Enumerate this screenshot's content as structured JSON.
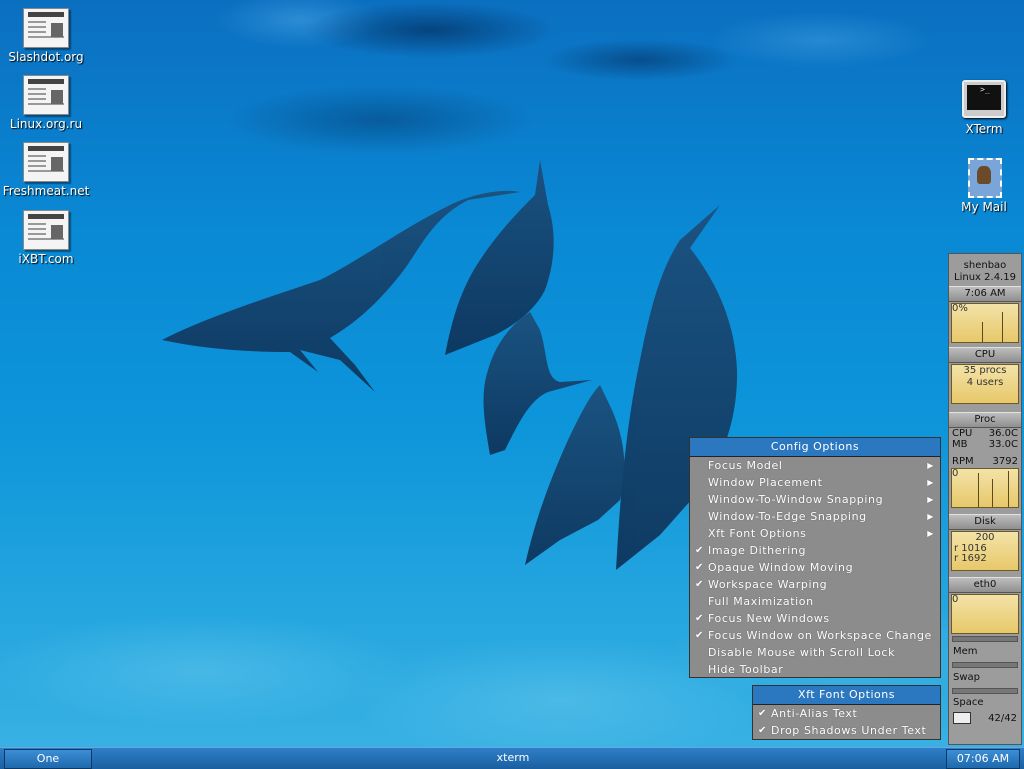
{
  "desktop": {
    "icons_left": [
      {
        "label": "Slashdot.org",
        "icon": "newspaper-icon"
      },
      {
        "label": "Linux.org.ru",
        "icon": "newspaper-icon"
      },
      {
        "label": "Freshmeat.net",
        "icon": "newspaper-icon"
      },
      {
        "label": "iXBT.com",
        "icon": "newspaper-icon"
      }
    ],
    "icons_right": [
      {
        "label": "XTerm",
        "icon": "terminal-icon",
        "glyph": ">_"
      },
      {
        "label": "My Mail",
        "icon": "mail-stamp-icon"
      }
    ]
  },
  "monitor": {
    "hostname": "shenbao",
    "kernel": "Linux 2.4.19",
    "time": "7:06 AM",
    "cpu_chart_text": "0%",
    "cpu_label": "CPU",
    "procs_line1": "35 procs",
    "procs_line2": "4 users",
    "proc_label": "Proc",
    "sensors": {
      "cpu_name": "CPU",
      "cpu_temp": "36.0C",
      "mb_name": "MB",
      "mb_temp": "33.0C",
      "rpm_name": "RPM",
      "rpm_value": "3792"
    },
    "disk_chart_text": "0",
    "disk_label": "Disk",
    "disk_line1": "200",
    "disk_line2": "r 1016",
    "disk_line3": "r 1692",
    "eth_label": "eth0",
    "eth_chart_text": "0",
    "mem_label": "Mem",
    "swap_label": "Swap",
    "space_label": "Space",
    "mail_count": "42/42"
  },
  "config_menu": {
    "title": "Config Options",
    "items": [
      {
        "label": "Focus Model",
        "checked": false,
        "submenu": true
      },
      {
        "label": "Window Placement",
        "checked": false,
        "submenu": true
      },
      {
        "label": "Window-To-Window Snapping",
        "checked": false,
        "submenu": true
      },
      {
        "label": "Window-To-Edge Snapping",
        "checked": false,
        "submenu": true
      },
      {
        "label": "Xft Font Options",
        "checked": false,
        "submenu": true
      },
      {
        "label": "Image Dithering",
        "checked": true,
        "submenu": false
      },
      {
        "label": "Opaque Window Moving",
        "checked": true,
        "submenu": false
      },
      {
        "label": "Workspace Warping",
        "checked": true,
        "submenu": false
      },
      {
        "label": "Full Maximization",
        "checked": false,
        "submenu": false
      },
      {
        "label": "Focus New Windows",
        "checked": true,
        "submenu": false
      },
      {
        "label": "Focus Window on Workspace Change",
        "checked": true,
        "submenu": false
      },
      {
        "label": "Disable Mouse with Scroll Lock",
        "checked": false,
        "submenu": false
      },
      {
        "label": "Hide Toolbar",
        "checked": false,
        "submenu": false
      }
    ]
  },
  "xft_menu": {
    "title": "Xft Font Options",
    "items": [
      {
        "label": "Anti-Alias Text",
        "checked": true
      },
      {
        "label": "Drop Shadows Under Text",
        "checked": true
      }
    ]
  },
  "taskbar": {
    "workspace": "One",
    "task": "xterm",
    "clock": "07:06 AM"
  },
  "glyphs": {
    "check": "✔",
    "arrow": "▶"
  },
  "colors": {
    "menu_title": "#2b78c0",
    "menu_bg": "#8c8c8c",
    "taskbar": "#1a5fa0"
  }
}
